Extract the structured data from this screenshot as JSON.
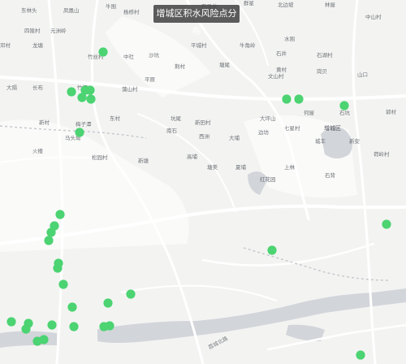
{
  "map": {
    "title": "增城区积水风险点分布",
    "marker_color": "#4cd372",
    "district_badge": "增城区",
    "road_label": "荔城北路",
    "place_labels": [
      "东林头",
      "凤凰山",
      "牛围",
      "杨桥村",
      "陈家林",
      "石马龙",
      "群星",
      "北边坡",
      "林屋",
      "中山村",
      "四陵村",
      "元洲岭",
      "邓村",
      "龙塘",
      "竹丝村",
      "中社",
      "沙坑",
      "平城村",
      "牛角岭",
      "水围",
      "石井",
      "石湖村",
      "大隔",
      "长布",
      "竹阁",
      "蒲山村",
      "平原",
      "荆村",
      "塘尾",
      "黄村",
      "岗贝",
      "文山村",
      "山口",
      "新村",
      "梅子潭",
      "东村",
      "坑尾",
      "新田村",
      "大坪山",
      "何屋",
      "石坑",
      "郭村",
      "火楼",
      "马头坳",
      "松园村",
      "新塘",
      "南石",
      "西洲",
      "大埔",
      "边坊",
      "七星村",
      "城丰",
      "新安",
      "荷岭村",
      "高埔",
      "塘美",
      "夏埔",
      "红花园",
      "上林",
      "石背"
    ]
  }
}
